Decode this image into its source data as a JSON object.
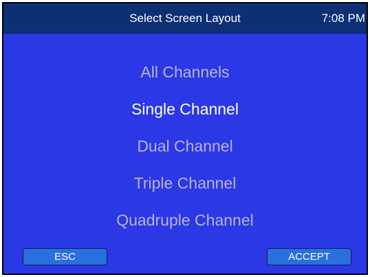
{
  "header": {
    "title": "Select Screen Layout",
    "time": "7:08 PM"
  },
  "menu": {
    "items": [
      {
        "label": "All Channels",
        "selected": false
      },
      {
        "label": "Single Channel",
        "selected": true
      },
      {
        "label": "Dual Channel",
        "selected": false
      },
      {
        "label": "Triple Channel",
        "selected": false
      },
      {
        "label": "Quadruple Channel",
        "selected": false
      }
    ]
  },
  "buttons": {
    "esc_label": "ESC",
    "accept_label": "ACCEPT"
  },
  "colors": {
    "screen_background": "#2b38e6",
    "title_bar": "#0d3075",
    "item_normal": "#b8b3d6",
    "item_selected": "#ffffff",
    "button_fill": "#2a6fe0"
  }
}
